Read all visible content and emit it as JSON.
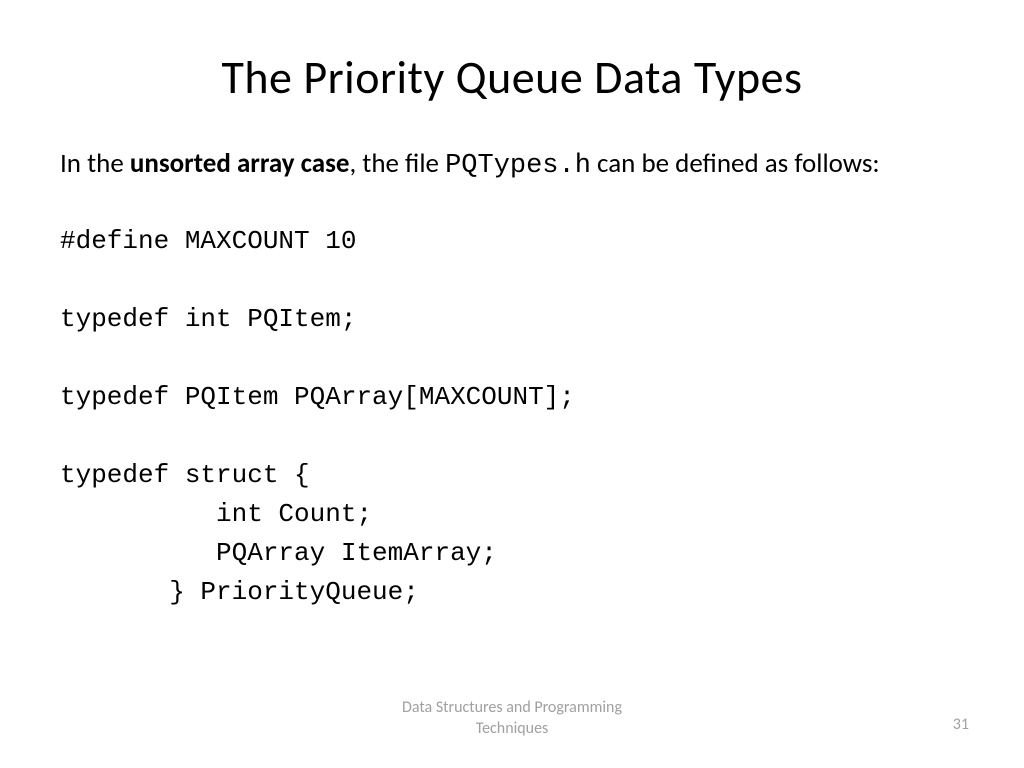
{
  "slide": {
    "title": "The Priority Queue Data Types",
    "intro": {
      "prefix": "In the ",
      "bold": "unsorted array case",
      "mid": ", the file ",
      "filename": "PQTypes.h",
      "suffix": "  can be defined as follows:"
    },
    "code": "#define MAXCOUNT 10\n\ntypedef int PQItem;\n\ntypedef PQItem PQArray[MAXCOUNT];\n\ntypedef struct {\n          int Count;\n          PQArray ItemArray;\n       } PriorityQueue;",
    "footer": {
      "line1": "Data Structures and Programming",
      "line2": "Techniques"
    },
    "page_number": "31"
  }
}
